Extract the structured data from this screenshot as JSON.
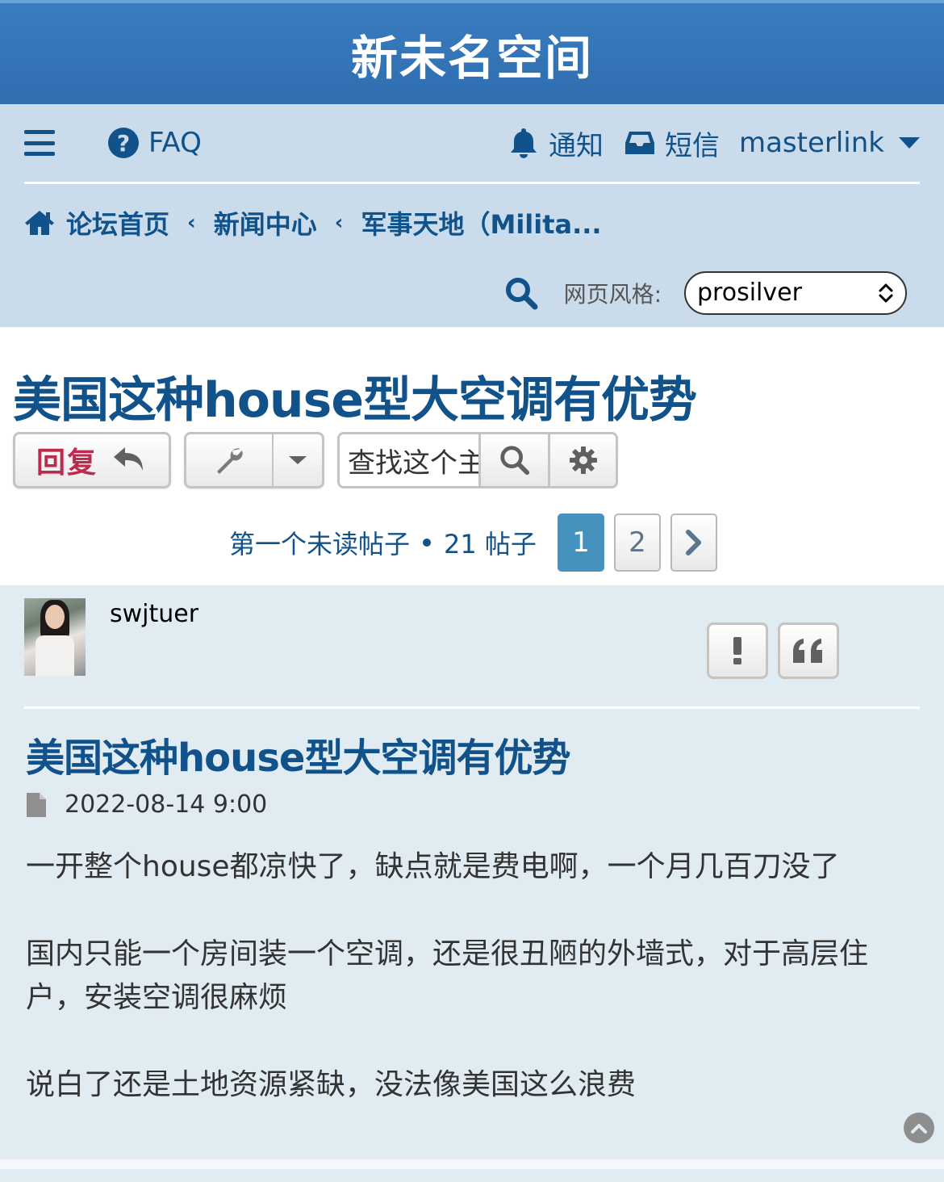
{
  "site": {
    "title": "新未名空间"
  },
  "nav": {
    "faq_label": "FAQ",
    "notifications_label": "通知",
    "messages_label": "短信",
    "username": "masterlink"
  },
  "breadcrumb": {
    "items": [
      "论坛首页",
      "新闻中心",
      "军事天地（Milita..."
    ]
  },
  "style_switcher": {
    "label": "网页风格:",
    "selected": "prosilver"
  },
  "topic": {
    "title": "美国这种house型大空调有优势",
    "reply_label": "回复",
    "search_placeholder": "查找这个主题…",
    "first_unread_label": "第一个未读帖子",
    "post_count": "21 帖子",
    "pages": [
      "1",
      "2"
    ],
    "current_page": "1"
  },
  "post": {
    "author": "swjtuer",
    "subject": "美国这种house型大空调有优势",
    "timestamp": "2022-08-14 9:00",
    "paragraphs": [
      "一开整个house都凉快了，缺点就是费电啊，一个月几百刀没了",
      "国内只能一个房间装一个空调，还是很丑陋的外墙式，对于高层住户，安装空调很麻烦",
      "说白了还是土地资源紧缺，没法像美国这么浪费"
    ]
  },
  "colors": {
    "header_blue": "#2f6eaf",
    "nav_bg": "#cadceb",
    "link_blue": "#105289",
    "reply_red": "#bc2a4d",
    "post_bg": "#e1ebf2",
    "active_page": "#4692bf"
  }
}
